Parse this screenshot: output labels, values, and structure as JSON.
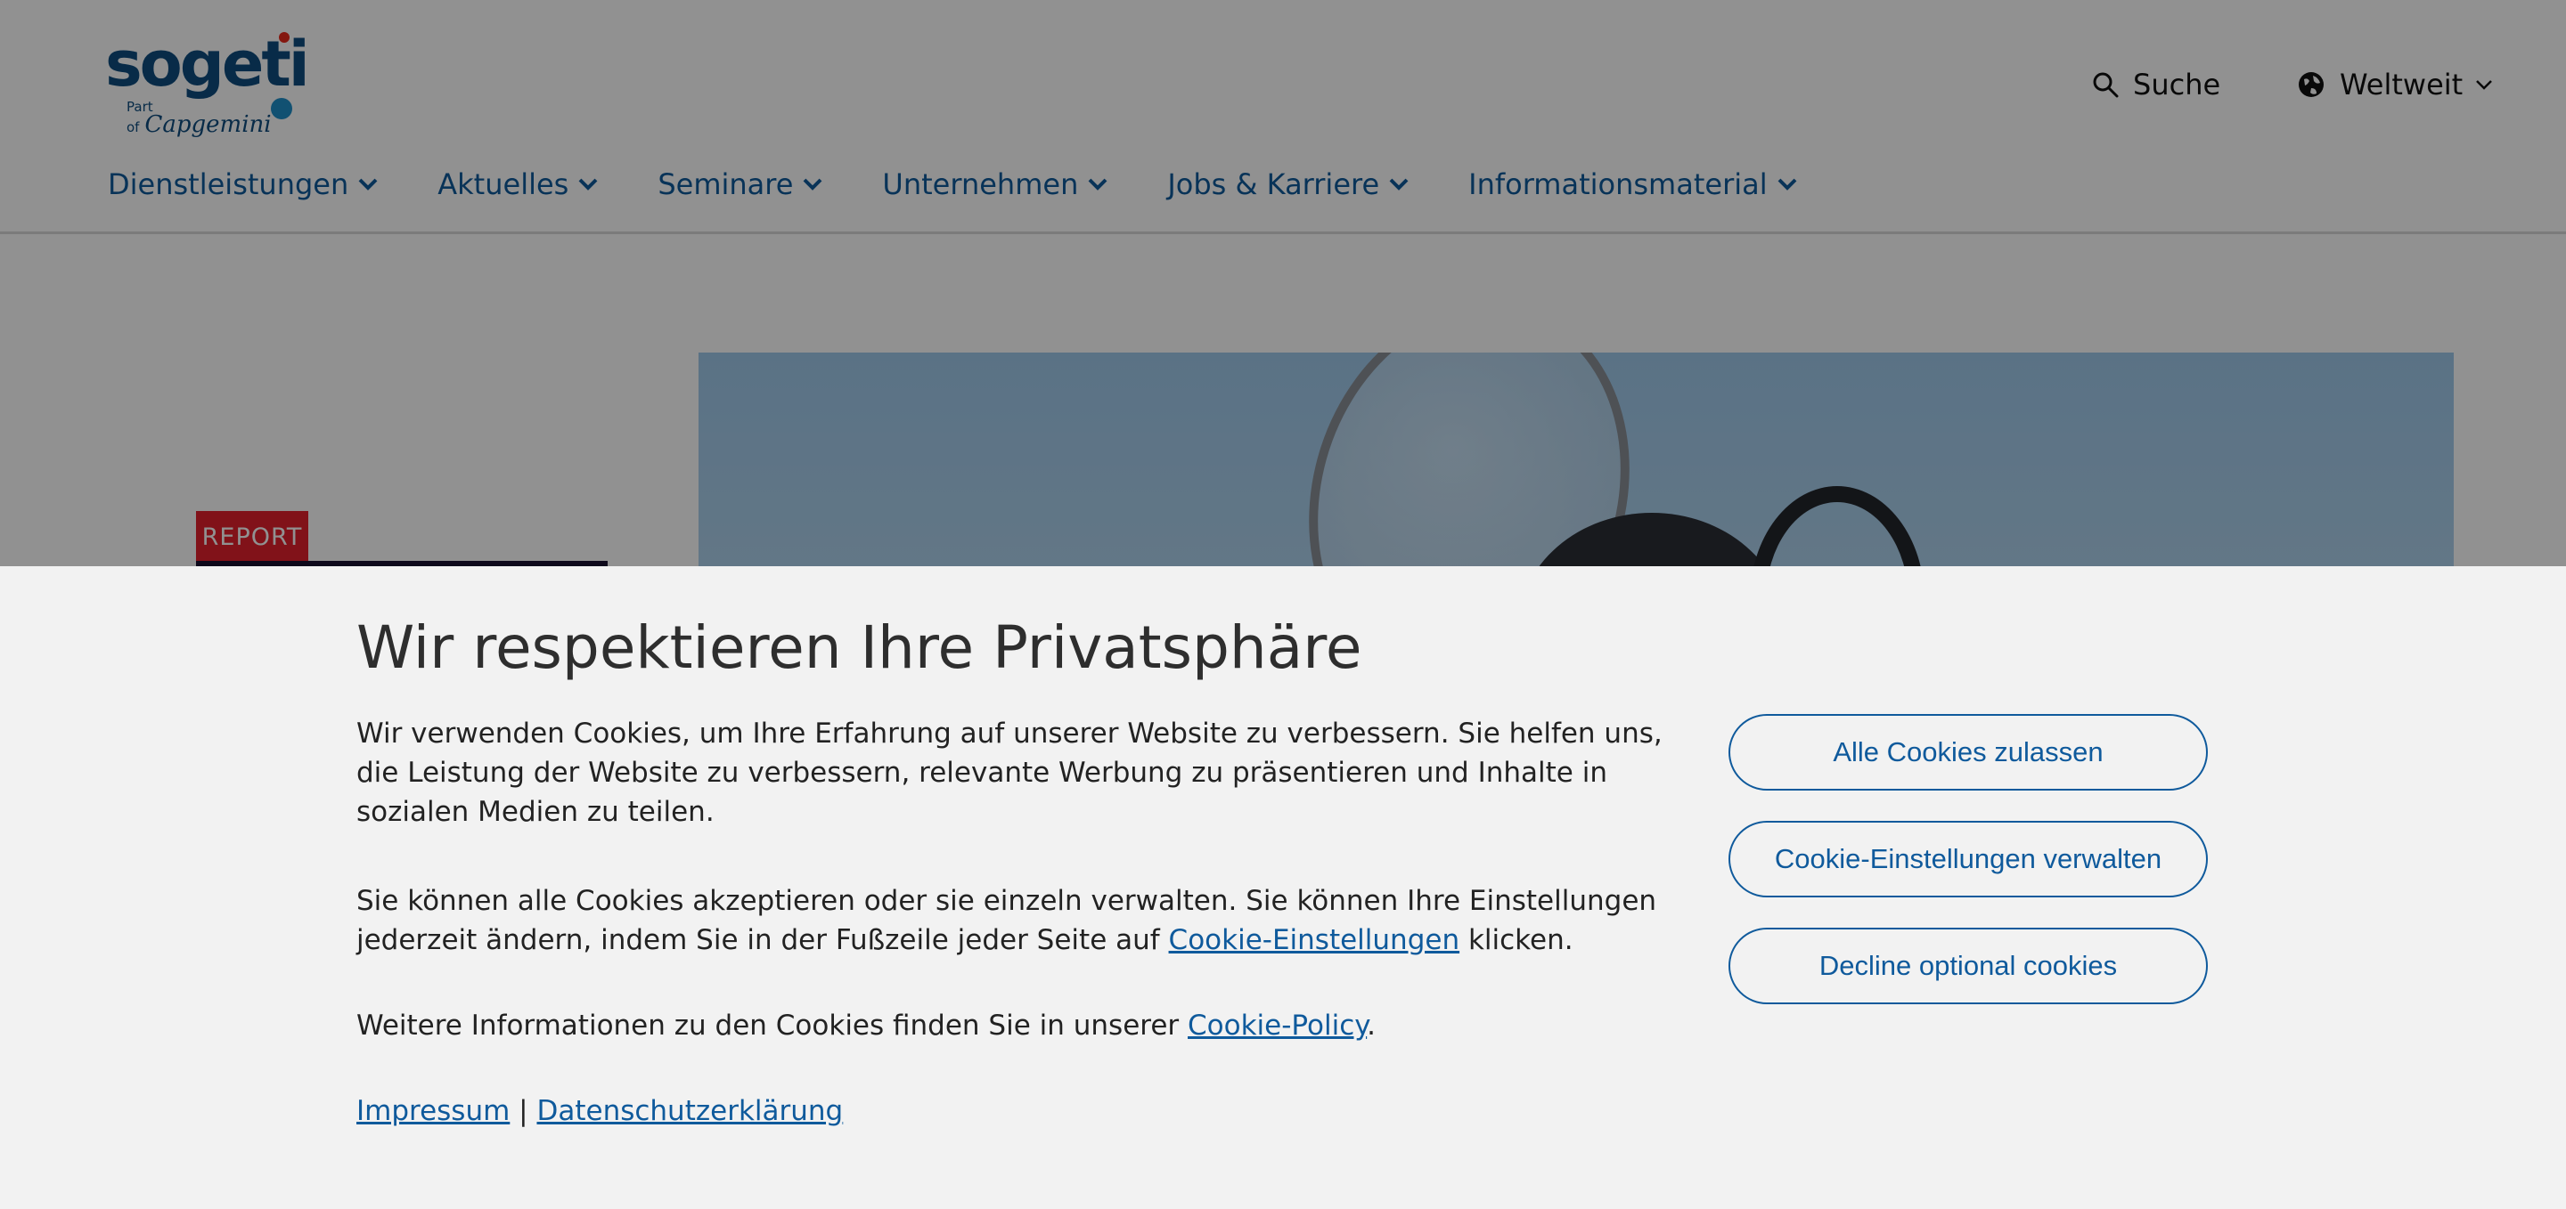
{
  "header": {
    "logo": {
      "word": "sogeti",
      "part_of": "Part of",
      "parent": "Capgemini"
    },
    "search_label": "Suche",
    "region_label": "Weltweit"
  },
  "nav": {
    "items": [
      {
        "label": "Dienstleistungen"
      },
      {
        "label": "Aktuelles"
      },
      {
        "label": "Seminare"
      },
      {
        "label": "Unternehmen"
      },
      {
        "label": "Jobs & Karriere"
      },
      {
        "label": "Informationsmaterial"
      }
    ]
  },
  "hero": {
    "tag": "REPORT"
  },
  "cookie_banner": {
    "title": "Wir respektieren Ihre Privatsphäre",
    "para1": "Wir verwenden Cookies, um Ihre Erfahrung auf unserer Website zu verbessern. Sie helfen uns, die Leistung der Website zu verbessern, relevante Werbung zu präsentieren und Inhalte in sozialen Medien zu teilen.",
    "para2_before": "Sie können alle Cookies akzeptieren oder sie einzeln verwalten. Sie können Ihre Einstellungen jederzeit ändern, indem Sie in der Fußzeile jeder Seite auf ",
    "para2_link": "Cookie-Einstellungen",
    "para2_after": " klicken.",
    "para3_before": "Weitere Informationen zu den Cookies finden Sie in unserer ",
    "para3_link": "Cookie-Policy",
    "para3_after": ".",
    "impressum": "Impressum",
    "separator": " | ",
    "datenschutz": "Datenschutzerklärung",
    "buttons": {
      "accept_all": "Alle Cookies zulassen",
      "manage": "Cookie-Einstellungen verwalten",
      "decline": "Decline optional cookies"
    }
  },
  "colors": {
    "brand_blue": "#0f5a9c",
    "tag_red": "#e3202c",
    "banner_bg": "#f2f2f2"
  }
}
